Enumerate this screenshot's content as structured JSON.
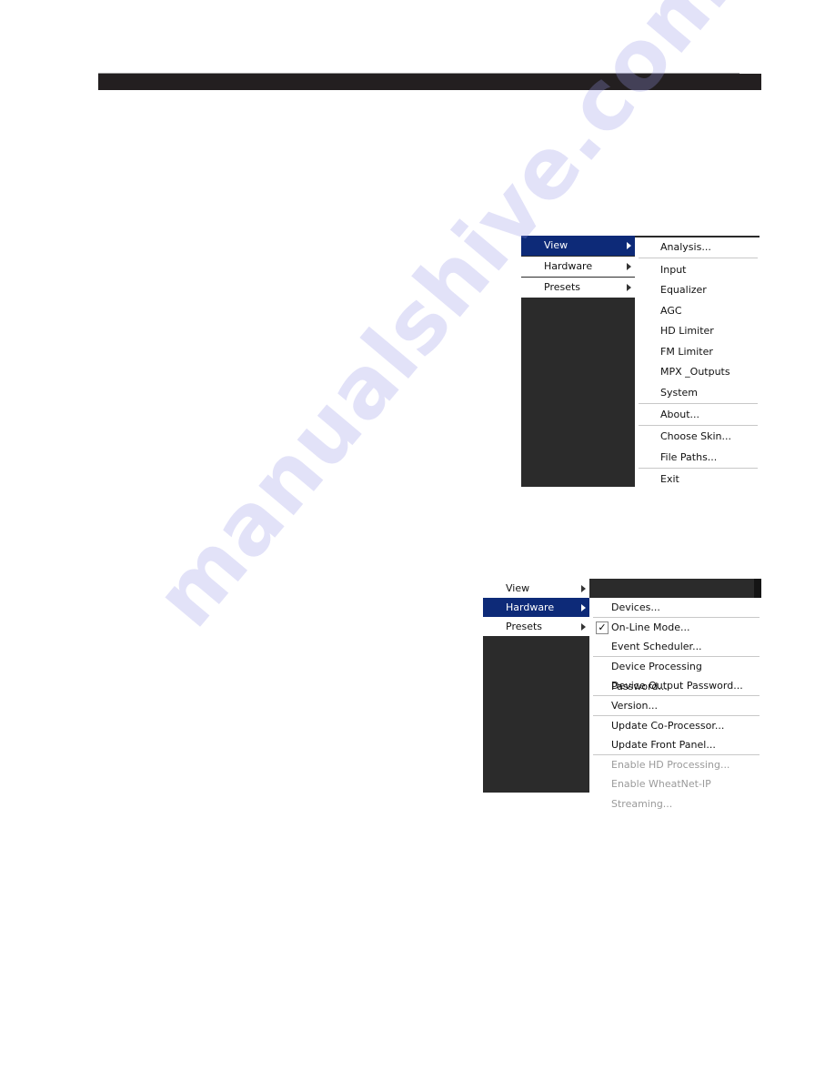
{
  "watermark": "manualshive.com",
  "colors": {
    "header_bar": "#231f20",
    "menu_highlight": "#0d2a78",
    "menu_dark_bg": "#2b2b2b",
    "disabled_text": "#9a9a9a"
  },
  "menu_view": {
    "main_items": [
      {
        "label": "View",
        "active": true
      },
      {
        "label": "Hardware",
        "active": false
      },
      {
        "label": "Presets",
        "active": false
      }
    ],
    "submenu": [
      {
        "label": "Analysis..."
      },
      {
        "label": "Input"
      },
      {
        "label": "Equalizer"
      },
      {
        "label": "AGC"
      },
      {
        "label": "HD Limiter"
      },
      {
        "label": "FM Limiter"
      },
      {
        "label": "MPX _Outputs"
      },
      {
        "label": "System"
      },
      {
        "label": "About..."
      },
      {
        "label": "Choose Skin..."
      },
      {
        "label": "File Paths..."
      },
      {
        "label": "Exit"
      }
    ]
  },
  "menu_hardware": {
    "main_items": [
      {
        "label": "View",
        "active": false
      },
      {
        "label": "Hardware",
        "active": true
      },
      {
        "label": "Presets",
        "active": false
      }
    ],
    "submenu": [
      {
        "label": "Devices...",
        "enabled": true
      },
      {
        "label": "On-Line Mode...",
        "enabled": true,
        "checked": true
      },
      {
        "label": "Event Scheduler...",
        "enabled": true
      },
      {
        "label": "Device Processing Password...",
        "enabled": true
      },
      {
        "label": "Device Output Password...",
        "enabled": true
      },
      {
        "label": "Version...",
        "enabled": true
      },
      {
        "label": "Update Co-Processor...",
        "enabled": true
      },
      {
        "label": "Update Front Panel...",
        "enabled": true
      },
      {
        "label": "Enable HD Processing...",
        "enabled": false
      },
      {
        "label": "Enable WheatNet-IP Streaming...",
        "enabled": false
      }
    ],
    "check_glyph": "✓"
  }
}
